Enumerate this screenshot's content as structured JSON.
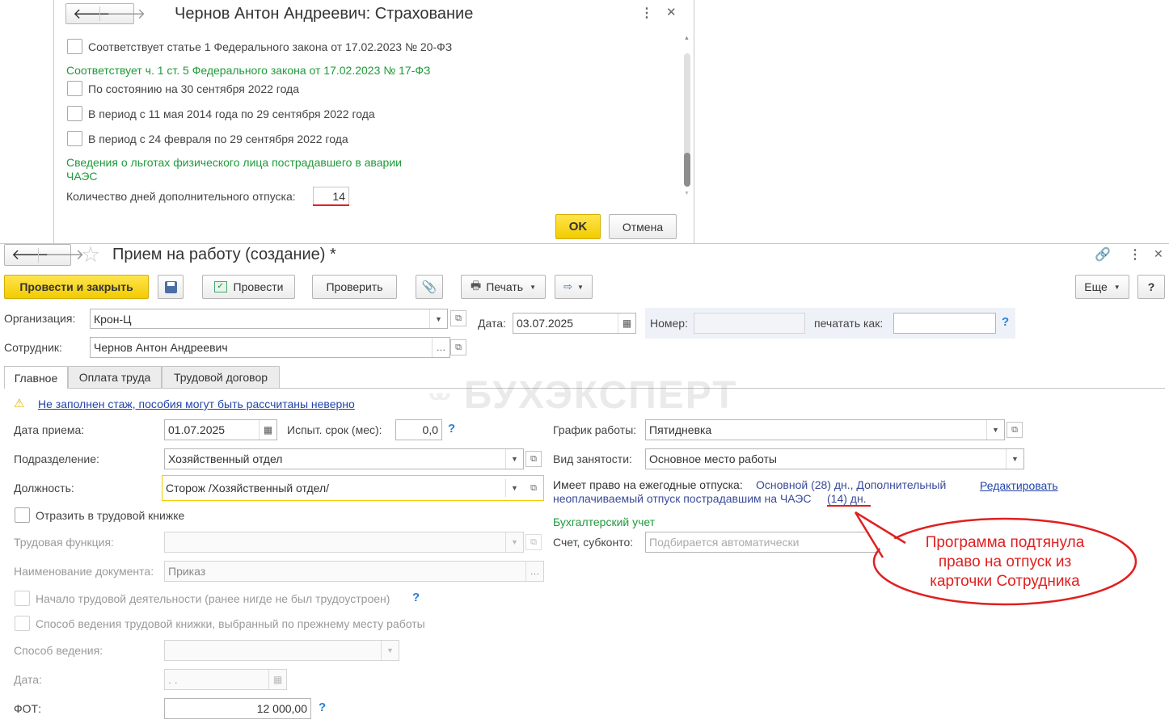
{
  "dialog": {
    "title": "Чернов Антон Андреевич: Страхование",
    "check_article1": "Соответствует статье 1 Федерального закона от 17.02.2023 № 20-ФЗ",
    "section_law17": "Соответствует ч. 1 ст. 5 Федерального закона от 17.02.2023 № 17-ФЗ",
    "check_sep30": "По состоянию на 30 сентября 2022 года",
    "check_may2014": "В период с 11 мая 2014 года по 29 сентября 2022 года",
    "check_feb24": "В период с 24 февраля по 29 сентября 2022 года",
    "section_chaes_line1": "Сведения о льготах физического лица пострадавшего в аварии",
    "section_chaes_line2": "ЧАЭС",
    "extra_days_label": "Количество дней дополнительного отпуска:",
    "extra_days_value": "14",
    "ok_label": "OK",
    "cancel_label": "Отмена"
  },
  "doc": {
    "title": "Прием на работу (создание) *",
    "toolbar": {
      "post_close": "Провести и закрыть",
      "post": "Провести",
      "check": "Проверить",
      "print": "Печать",
      "more": "Еще",
      "help": "?"
    },
    "header": {
      "org_label": "Организация:",
      "org_value": "Крон-Ц",
      "date_label": "Дата:",
      "date_value": "03.07.2025",
      "number_label": "Номер:",
      "number_value": "",
      "print_as_label": "печатать как:",
      "print_as_value": "",
      "employee_label": "Сотрудник:",
      "employee_value": "Чернов Антон Андреевич"
    },
    "tabs": [
      "Главное",
      "Оплата труда",
      "Трудовой договор"
    ],
    "watermark": "БУХЭКСПЕРТ",
    "main": {
      "warning": "Не заполнен стаж, пособия могут быть рассчитаны неверно",
      "hire_date_label": "Дата приема:",
      "hire_date_value": "01.07.2025",
      "probation_label": "Испыт. срок (мес):",
      "probation_value": "0,0",
      "dept_label": "Подразделение:",
      "dept_value": "Хозяйственный отдел",
      "position_label": "Должность:",
      "position_value": "Сторож /Хозяйственный отдел/",
      "workbook_label": "Отразить в трудовой книжке",
      "labor_func_label": "Трудовая функция:",
      "doc_name_label": "Наименование документа:",
      "doc_name_value": "Приказ",
      "career_start_label": "Начало трудовой деятельности (ранее нигде не был трудоустроен)",
      "book_method_prev_label": "Способ ведения трудовой книжки, выбранный по прежнему месту работы",
      "book_method_label": "Способ ведения:",
      "date_label": "Дата:",
      "date_value": " .  .",
      "fot_label": "ФОТ:",
      "fot_value": "12 000,00",
      "schedule_label": "График работы:",
      "schedule_value": "Пятидневка",
      "employment_label": "Вид занятости:",
      "employment_value": "Основное место работы",
      "vacation_label": "Имеет право на ежегодные отпуска:",
      "vacation_text_line1": "Основной (28) дн., Дополнительный",
      "vacation_text_line2": "неоплачиваемый отпуск пострадавшим на ЧАЭС",
      "vacation_days": "(14) дн.",
      "edit_link": "Редактировать",
      "accounting_label": "Бухгалтерский учет",
      "account_label": "Счет, субконто:",
      "account_placeholder": "Подбирается автоматически"
    }
  },
  "callout": {
    "line1": "Программа подтянула",
    "line2": "право на отпуск из",
    "line3": "карточки Сотрудника"
  },
  "colors": {
    "accent_yellow": "#f5d000",
    "callout_red": "#e02020",
    "green_text": "#1f9a3a",
    "link_blue": "#2244aa"
  }
}
